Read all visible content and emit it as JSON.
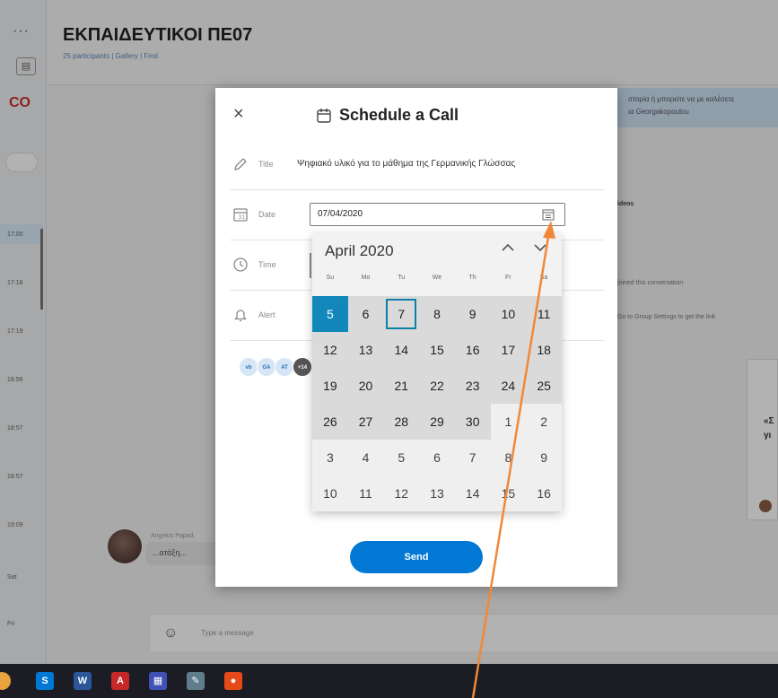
{
  "background": {
    "rail_dots": "···",
    "rail_box": "▤",
    "rail_logo": "CO",
    "rail_times": [
      "17:00",
      "17:18",
      "17:19",
      "18:56",
      "18:57",
      "18:57",
      "19:09",
      "Sat",
      "Fri"
    ],
    "chat_title": "ΕΚΠΑΙΔΕΥΤΙΚΟΙ ΠΕ07",
    "chat_subtitle": "25 participants | Gallery | Find",
    "banner_text_1": "στορία ή μπορείτε να με καλέσετε",
    "banner_text_2": "ια Georgakopoulou",
    "line_1": "ideos",
    "line_2": "joined this conversation",
    "line_3": "Go to Group Settings to get the link",
    "card_text_1": "«Σ",
    "card_text_2": "γι",
    "msg_sender": "Angelos Papad.",
    "msg_text": "...ατάξη...",
    "compose_placeholder": "Type a message"
  },
  "dialog": {
    "close": "×",
    "title": "Schedule a Call",
    "fields": {
      "title_label": "Title",
      "title_value": "Ψηφιακό υλικό για το μάθημα της Γερμανικής Γλώσσας",
      "date_label": "Date",
      "date_value": "07/04/2020",
      "time_label": "Time",
      "alert_label": "Alert"
    },
    "invitees": [
      "vb",
      "GA",
      "AT",
      "+14"
    ],
    "send_label": "Send"
  },
  "calendar": {
    "month": "April 2020",
    "prev": "^",
    "next": "v",
    "weekdays": [
      "Su",
      "Mo",
      "Tu",
      "We",
      "Th",
      "Fr",
      "Sa"
    ],
    "days": [
      {
        "d": "5",
        "cls": "selected"
      },
      {
        "d": "6",
        "cls": ""
      },
      {
        "d": "7",
        "cls": "today"
      },
      {
        "d": "8",
        "cls": ""
      },
      {
        "d": "9",
        "cls": ""
      },
      {
        "d": "10",
        "cls": ""
      },
      {
        "d": "11",
        "cls": ""
      },
      {
        "d": "12",
        "cls": ""
      },
      {
        "d": "13",
        "cls": ""
      },
      {
        "d": "14",
        "cls": ""
      },
      {
        "d": "15",
        "cls": ""
      },
      {
        "d": "16",
        "cls": ""
      },
      {
        "d": "17",
        "cls": ""
      },
      {
        "d": "18",
        "cls": ""
      },
      {
        "d": "19",
        "cls": ""
      },
      {
        "d": "20",
        "cls": ""
      },
      {
        "d": "21",
        "cls": ""
      },
      {
        "d": "22",
        "cls": ""
      },
      {
        "d": "23",
        "cls": ""
      },
      {
        "d": "24",
        "cls": ""
      },
      {
        "d": "25",
        "cls": ""
      },
      {
        "d": "26",
        "cls": ""
      },
      {
        "d": "27",
        "cls": ""
      },
      {
        "d": "28",
        "cls": ""
      },
      {
        "d": "29",
        "cls": ""
      },
      {
        "d": "30",
        "cls": ""
      },
      {
        "d": "1",
        "cls": "other"
      },
      {
        "d": "2",
        "cls": "other"
      },
      {
        "d": "3",
        "cls": "other"
      },
      {
        "d": "4",
        "cls": "other"
      },
      {
        "d": "5",
        "cls": "other"
      },
      {
        "d": "6",
        "cls": "other"
      },
      {
        "d": "7",
        "cls": "other"
      },
      {
        "d": "8",
        "cls": "other"
      },
      {
        "d": "9",
        "cls": "other"
      },
      {
        "d": "10",
        "cls": "other"
      },
      {
        "d": "11",
        "cls": "other"
      },
      {
        "d": "12",
        "cls": "other"
      },
      {
        "d": "13",
        "cls": "other"
      },
      {
        "d": "14",
        "cls": "other"
      },
      {
        "d": "15",
        "cls": "other"
      },
      {
        "d": "16",
        "cls": "other"
      }
    ]
  },
  "taskbar": {
    "icons": [
      {
        "name": "skype-taskbar-icon",
        "glyph": "S",
        "color": "#0078d4"
      },
      {
        "name": "word-taskbar-icon",
        "glyph": "W",
        "color": "#2b579a"
      },
      {
        "name": "acrobat-taskbar-icon",
        "glyph": "A",
        "color": "#c62828"
      },
      {
        "name": "app-taskbar-icon",
        "glyph": "▦",
        "color": "#3f51b5"
      },
      {
        "name": "tool-taskbar-icon",
        "glyph": "✎",
        "color": "#607d8b"
      },
      {
        "name": "browser-taskbar-icon",
        "glyph": "●",
        "color": "#e64a19"
      }
    ]
  },
  "colors": {
    "accent": "#0078d4",
    "selected_day": "#1288ba",
    "annotation_arrow": "#f0883a"
  }
}
